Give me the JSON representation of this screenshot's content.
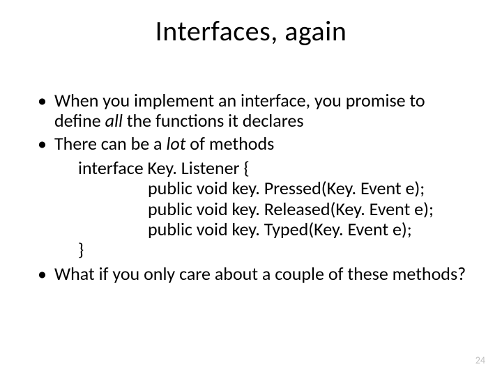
{
  "title": "Interfaces, again",
  "bullets": {
    "b1a": "When you implement an interface, you promise to define ",
    "b1_all": "all",
    "b1b": " the functions it declares",
    "b2a": "There can be a ",
    "b2_lot": "lot",
    "b2b": " of methods",
    "b3": "What if you only care about a couple of these methods?"
  },
  "code": {
    "l1": "interface Key. Listener {",
    "l2": "public void key. Pressed(Key. Event e);",
    "l3": "public void key. Released(Key. Event e);",
    "l4": "public void key. Typed(Key. Event e);",
    "l5": "}"
  },
  "page_number": "24"
}
